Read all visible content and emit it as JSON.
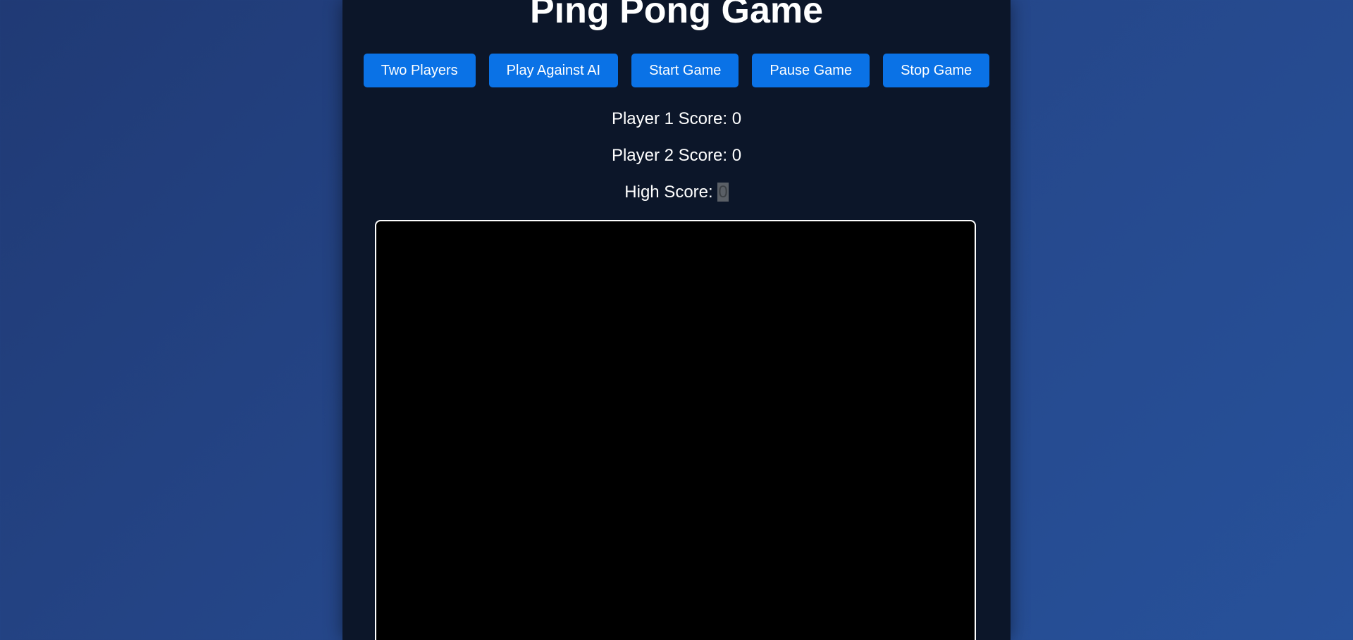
{
  "header": {
    "title": "Ping Pong Game"
  },
  "controls": {
    "two_players": "Two Players",
    "play_ai": "Play Against AI",
    "start": "Start Game",
    "pause": "Pause Game",
    "stop": "Stop Game"
  },
  "scores": {
    "player1_label": "Player 1 Score: ",
    "player1_value": "0",
    "player2_label": "Player 2 Score: ",
    "player2_value": "0",
    "high_label": "High Score: ",
    "high_value": "0"
  },
  "colors": {
    "background": "#25478a",
    "panel": "#0c1629",
    "button": "#0a72e6",
    "board": "#000000",
    "board_border": "#ffffff"
  }
}
